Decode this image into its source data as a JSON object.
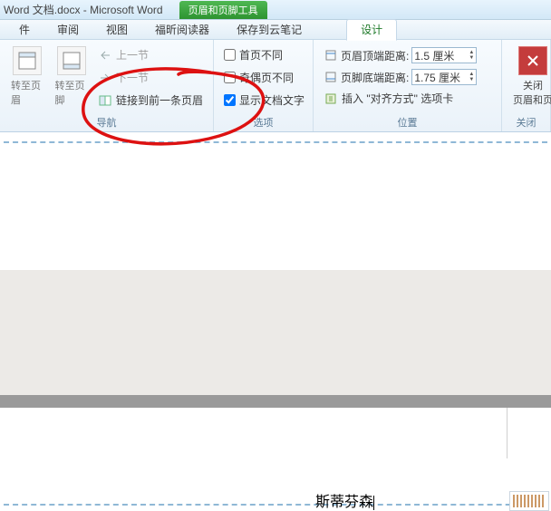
{
  "title": {
    "doc": "Word 文档.docx - Microsoft Word",
    "tool": "页眉和页脚工具"
  },
  "menu": {
    "t1": "件",
    "t2": "审阅",
    "t3": "视图",
    "t4": "福昕阅读器",
    "t5": "保存到云笔记",
    "t6": "设计"
  },
  "nav": {
    "goto_header": "转至页眉",
    "goto_footer": "转至页脚",
    "prev": "上一节",
    "next": "下一节",
    "link_prev": "链接到前一条页眉",
    "label": "导航"
  },
  "opts": {
    "diff_first": "首页不同",
    "diff_oddeven": "奇偶页不同",
    "show_doc": "显示文档文字",
    "label": "选项"
  },
  "pos": {
    "header_dist": "页眉顶端距离:",
    "header_val": "1.5 厘米",
    "footer_dist": "页脚底端距离:",
    "footer_val": "1.75 厘米",
    "align_tab": "插入 \"对齐方式\" 选项卡",
    "label": "位置"
  },
  "close": {
    "btn": "关闭\n页眉和页",
    "label": "关闭"
  },
  "doc": {
    "header_text": "斯蒂芬森"
  }
}
